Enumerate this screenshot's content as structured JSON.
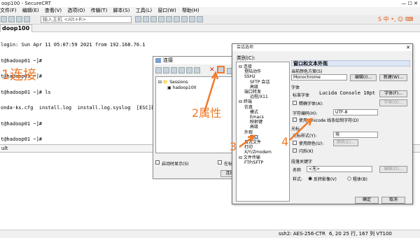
{
  "window": {
    "title": "oop100 - SecureCRT"
  },
  "menu": [
    "文件(F)",
    "编辑(E)",
    "查看(V)",
    "选项(O)",
    "传输(T)",
    "脚本(S)",
    "工具(L)",
    "窗口(W)",
    "帮助(H)"
  ],
  "toolbar": {
    "address_placeholder": "输入主机 <Alt+R>"
  },
  "tab": {
    "label": "doop100"
  },
  "terminal": {
    "lines": [
      "login: Sun Apr 11 05:07:59 2021 from 192.168.76.1",
      "t@hadoop01 ~]#",
      "t@hadoop01 ~]#",
      "t@hadoop01 ~]# ls",
      "onda-ks.cfg  install.log  install.log.syslog  [ESC]视频[0m  下载  公共  桌面  ...",
      "t@hadoop01 ~]#",
      "t@hadoop01 ~]#"
    ]
  },
  "cmdbar": {
    "label": "ult"
  },
  "annotations": {
    "a1": "1连接",
    "a2": "2属性",
    "a3": "3",
    "a4": "4"
  },
  "sessions_dialog": {
    "title": "连接",
    "tree": {
      "root": "Sessions",
      "child": "hadoop100"
    },
    "checkbox_startup": "启动时显示(S)",
    "checkbox_tab": "在标签",
    "connect_button": "连接(C)"
  },
  "options_dialog": {
    "title": "会话选项",
    "category_label": "类别(C):",
    "tree": [
      {
        "level": 0,
        "label": "连接"
      },
      {
        "level": 1,
        "label": "登陆动作"
      },
      {
        "level": 1,
        "label": "SSH2"
      },
      {
        "level": 2,
        "label": "SFTP 会话"
      },
      {
        "level": 2,
        "label": "高级"
      },
      {
        "level": 1,
        "label": "端口转发"
      },
      {
        "level": 2,
        "label": "远程/X11"
      },
      {
        "level": 0,
        "label": "终端"
      },
      {
        "level": 1,
        "label": "仿真"
      },
      {
        "level": 2,
        "label": "模式"
      },
      {
        "level": 2,
        "label": "Emacs"
      },
      {
        "level": 2,
        "label": "映射键"
      },
      {
        "level": 2,
        "label": "高级"
      },
      {
        "level": 1,
        "label": "外观"
      },
      {
        "level": 2,
        "label": "窗口"
      },
      {
        "level": 1,
        "label": "日志文件"
      },
      {
        "level": 1,
        "label": "打印"
      },
      {
        "level": 1,
        "label": "X/Y/Zmodem"
      },
      {
        "level": 0,
        "label": "文件传输"
      },
      {
        "level": 1,
        "label": "FTP/SFTP"
      }
    ],
    "panel": {
      "header": "窗口和文本外观",
      "color_scheme_label": "当前颜色方案(S)",
      "color_scheme_value": "Monochrome",
      "edit_button": "编辑(I)...",
      "new_button": "新建(W)...",
      "font_section": "字体",
      "standard_font_label": "标准字体",
      "font_value": "Lucida Console 10pt",
      "font_button": "字体(F)...",
      "precise_font_label": "精确字体(A):",
      "precise_font_button": "字体(O)...",
      "charset_label": "字符编码(H):",
      "charset_value": "UTF-8",
      "unicode_label": "使用 Unicode 线条绘制字符(D)",
      "cursor_section": "光标",
      "cursor_style_label": "光标样式(Y):",
      "cursor_style_value": "块",
      "cursor_color_label": "使用颜色(U):",
      "cursor_color_button": "颜色(L)...",
      "blink_label": "闪烁(K)",
      "keyword_section": "段落关键字",
      "name_label": "名称",
      "name_value": "<无>",
      "keyword_edit_button": "编辑(D)...",
      "style_label": "样式:",
      "radio_reverse": "反转影像(V)",
      "radio_bold": "粗体(B)",
      "ok_button": "确定",
      "cancel_button": "取消"
    }
  },
  "statusbar": {
    "protocol": "ssh2: AES-256-CTR",
    "position": "6, 20  25 行, 167 列 VT100"
  },
  "colors": {
    "annotation": "#f07a2a",
    "panel_header": "#dde6f5"
  }
}
